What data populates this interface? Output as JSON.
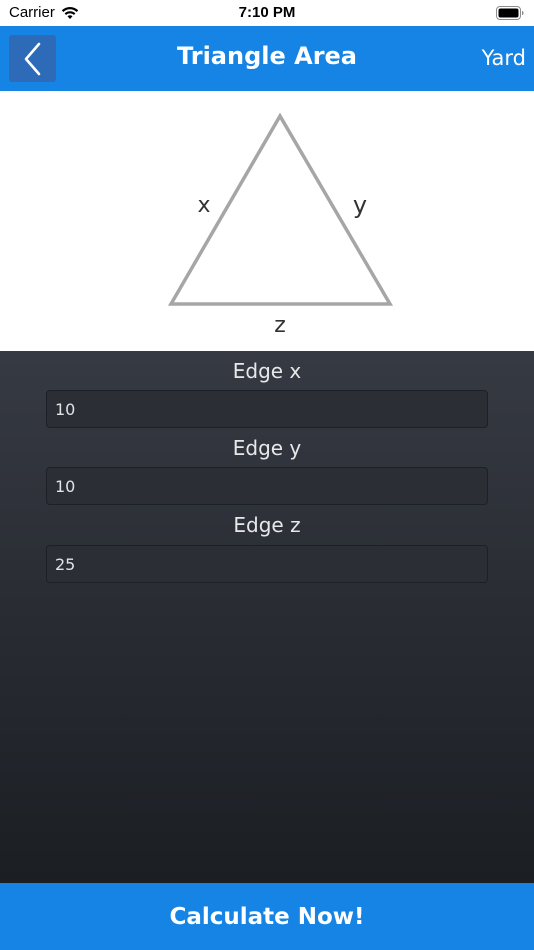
{
  "status_bar": {
    "carrier": "Carrier",
    "time": "7:10 PM"
  },
  "nav": {
    "title": "Triangle Area",
    "unit": "Yard",
    "back_icon": "chevron-left-icon"
  },
  "diagram": {
    "label_x": "x",
    "label_y": "y",
    "label_z": "z"
  },
  "form": {
    "fields": [
      {
        "label": "Edge x",
        "value": "10"
      },
      {
        "label": "Edge y",
        "value": "10"
      },
      {
        "label": "Edge z",
        "value": "25"
      }
    ]
  },
  "actions": {
    "calculate_label": "Calculate Now!"
  },
  "colors": {
    "accent": "#1584e4",
    "back_button": "#2d6ab7",
    "triangle_stroke": "#a6a6a6"
  }
}
